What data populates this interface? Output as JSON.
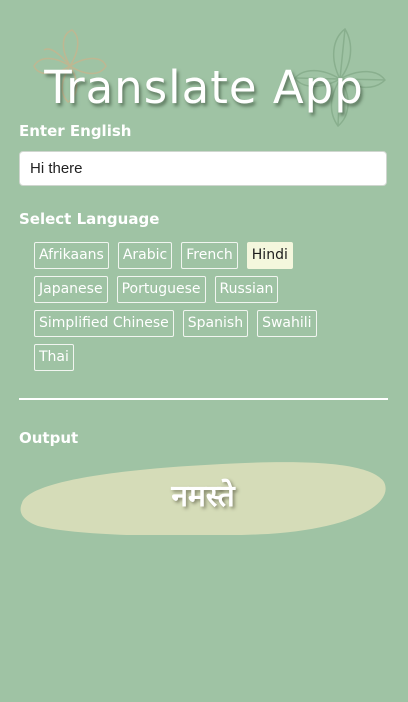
{
  "app": {
    "title": "Translate App"
  },
  "input_section": {
    "label": "Enter English",
    "value": "Hi there"
  },
  "language_section": {
    "label": "Select Language",
    "languages": [
      "Afrikaans",
      "Arabic",
      "French",
      "Hindi",
      "Japanese",
      "Portuguese",
      "Russian",
      "Simplified Chinese",
      "Spanish",
      "Swahili",
      "Thai"
    ],
    "selected": "Hindi"
  },
  "output_section": {
    "label": "Output",
    "text": "नमस्ते"
  },
  "colors": {
    "background": "#9fc3a4",
    "selected_button": "#f4f7dd",
    "output_blob": "#d5dcb8"
  },
  "icons": {
    "left_decoration": "flower-outline-icon",
    "right_decoration": "leaf-outline-icon"
  }
}
